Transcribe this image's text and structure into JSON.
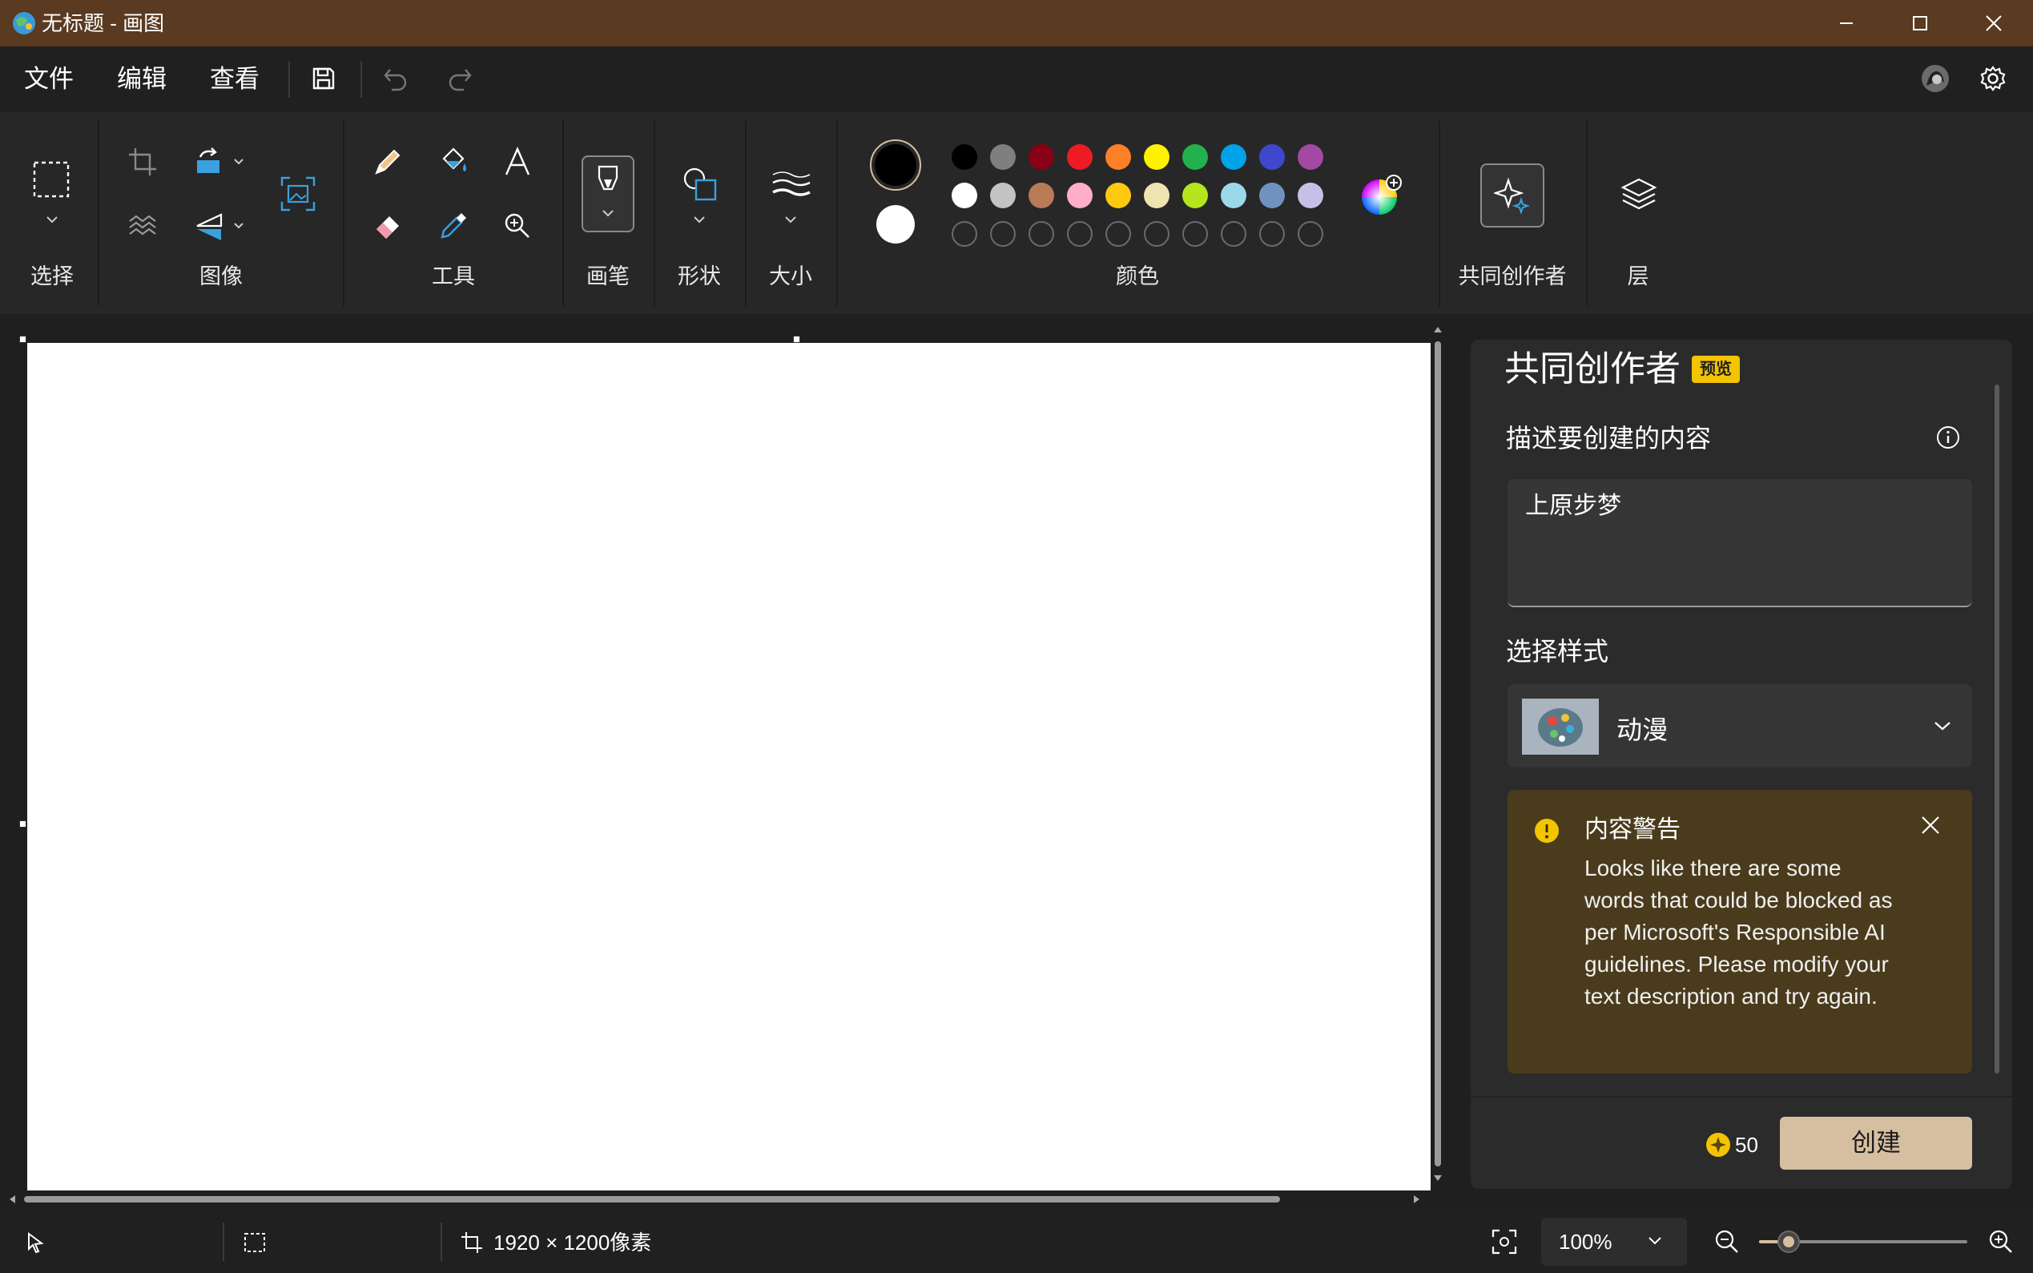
{
  "window": {
    "title": "无标题 - 画图"
  },
  "menu": {
    "file": "文件",
    "edit": "编辑",
    "view": "查看"
  },
  "ribbon": {
    "groups": {
      "select": "选择",
      "image": "图像",
      "tools": "工具",
      "brush": "画笔",
      "shapes": "形状",
      "size": "大小",
      "colors": "颜色",
      "cocreator": "共同创作者",
      "layers": "层"
    },
    "primary_color": "#000000",
    "secondary_color": "#ffffff",
    "palette_row1": [
      "#000000",
      "#7f7f7f",
      "#880015",
      "#ed1c24",
      "#ff7f27",
      "#fff200",
      "#22b14c",
      "#00a2e8",
      "#3f48cc",
      "#a349a4"
    ],
    "palette_row2": [
      "#ffffff",
      "#c3c3c3",
      "#b97a57",
      "#ffaec9",
      "#ffc90e",
      "#efe4b0",
      "#b5e61d",
      "#99d9ea",
      "#7092be",
      "#c8bfe7"
    ]
  },
  "panel": {
    "title": "共同创作者",
    "badge": "预览",
    "describe_label": "描述要创建的内容",
    "prompt_value": "上原步梦",
    "style_label": "选择样式",
    "style_value": "动漫",
    "warning_title": "内容警告",
    "warning_text": "Looks like there are some words that could be blocked as per Microsoft's Responsible AI guidelines. Please modify your text description and try again.",
    "credits": "50",
    "create_label": "创建"
  },
  "status": {
    "dimensions": "1920 × 1200像素",
    "zoom": "100%",
    "zoom_slider_level": 0.1
  }
}
